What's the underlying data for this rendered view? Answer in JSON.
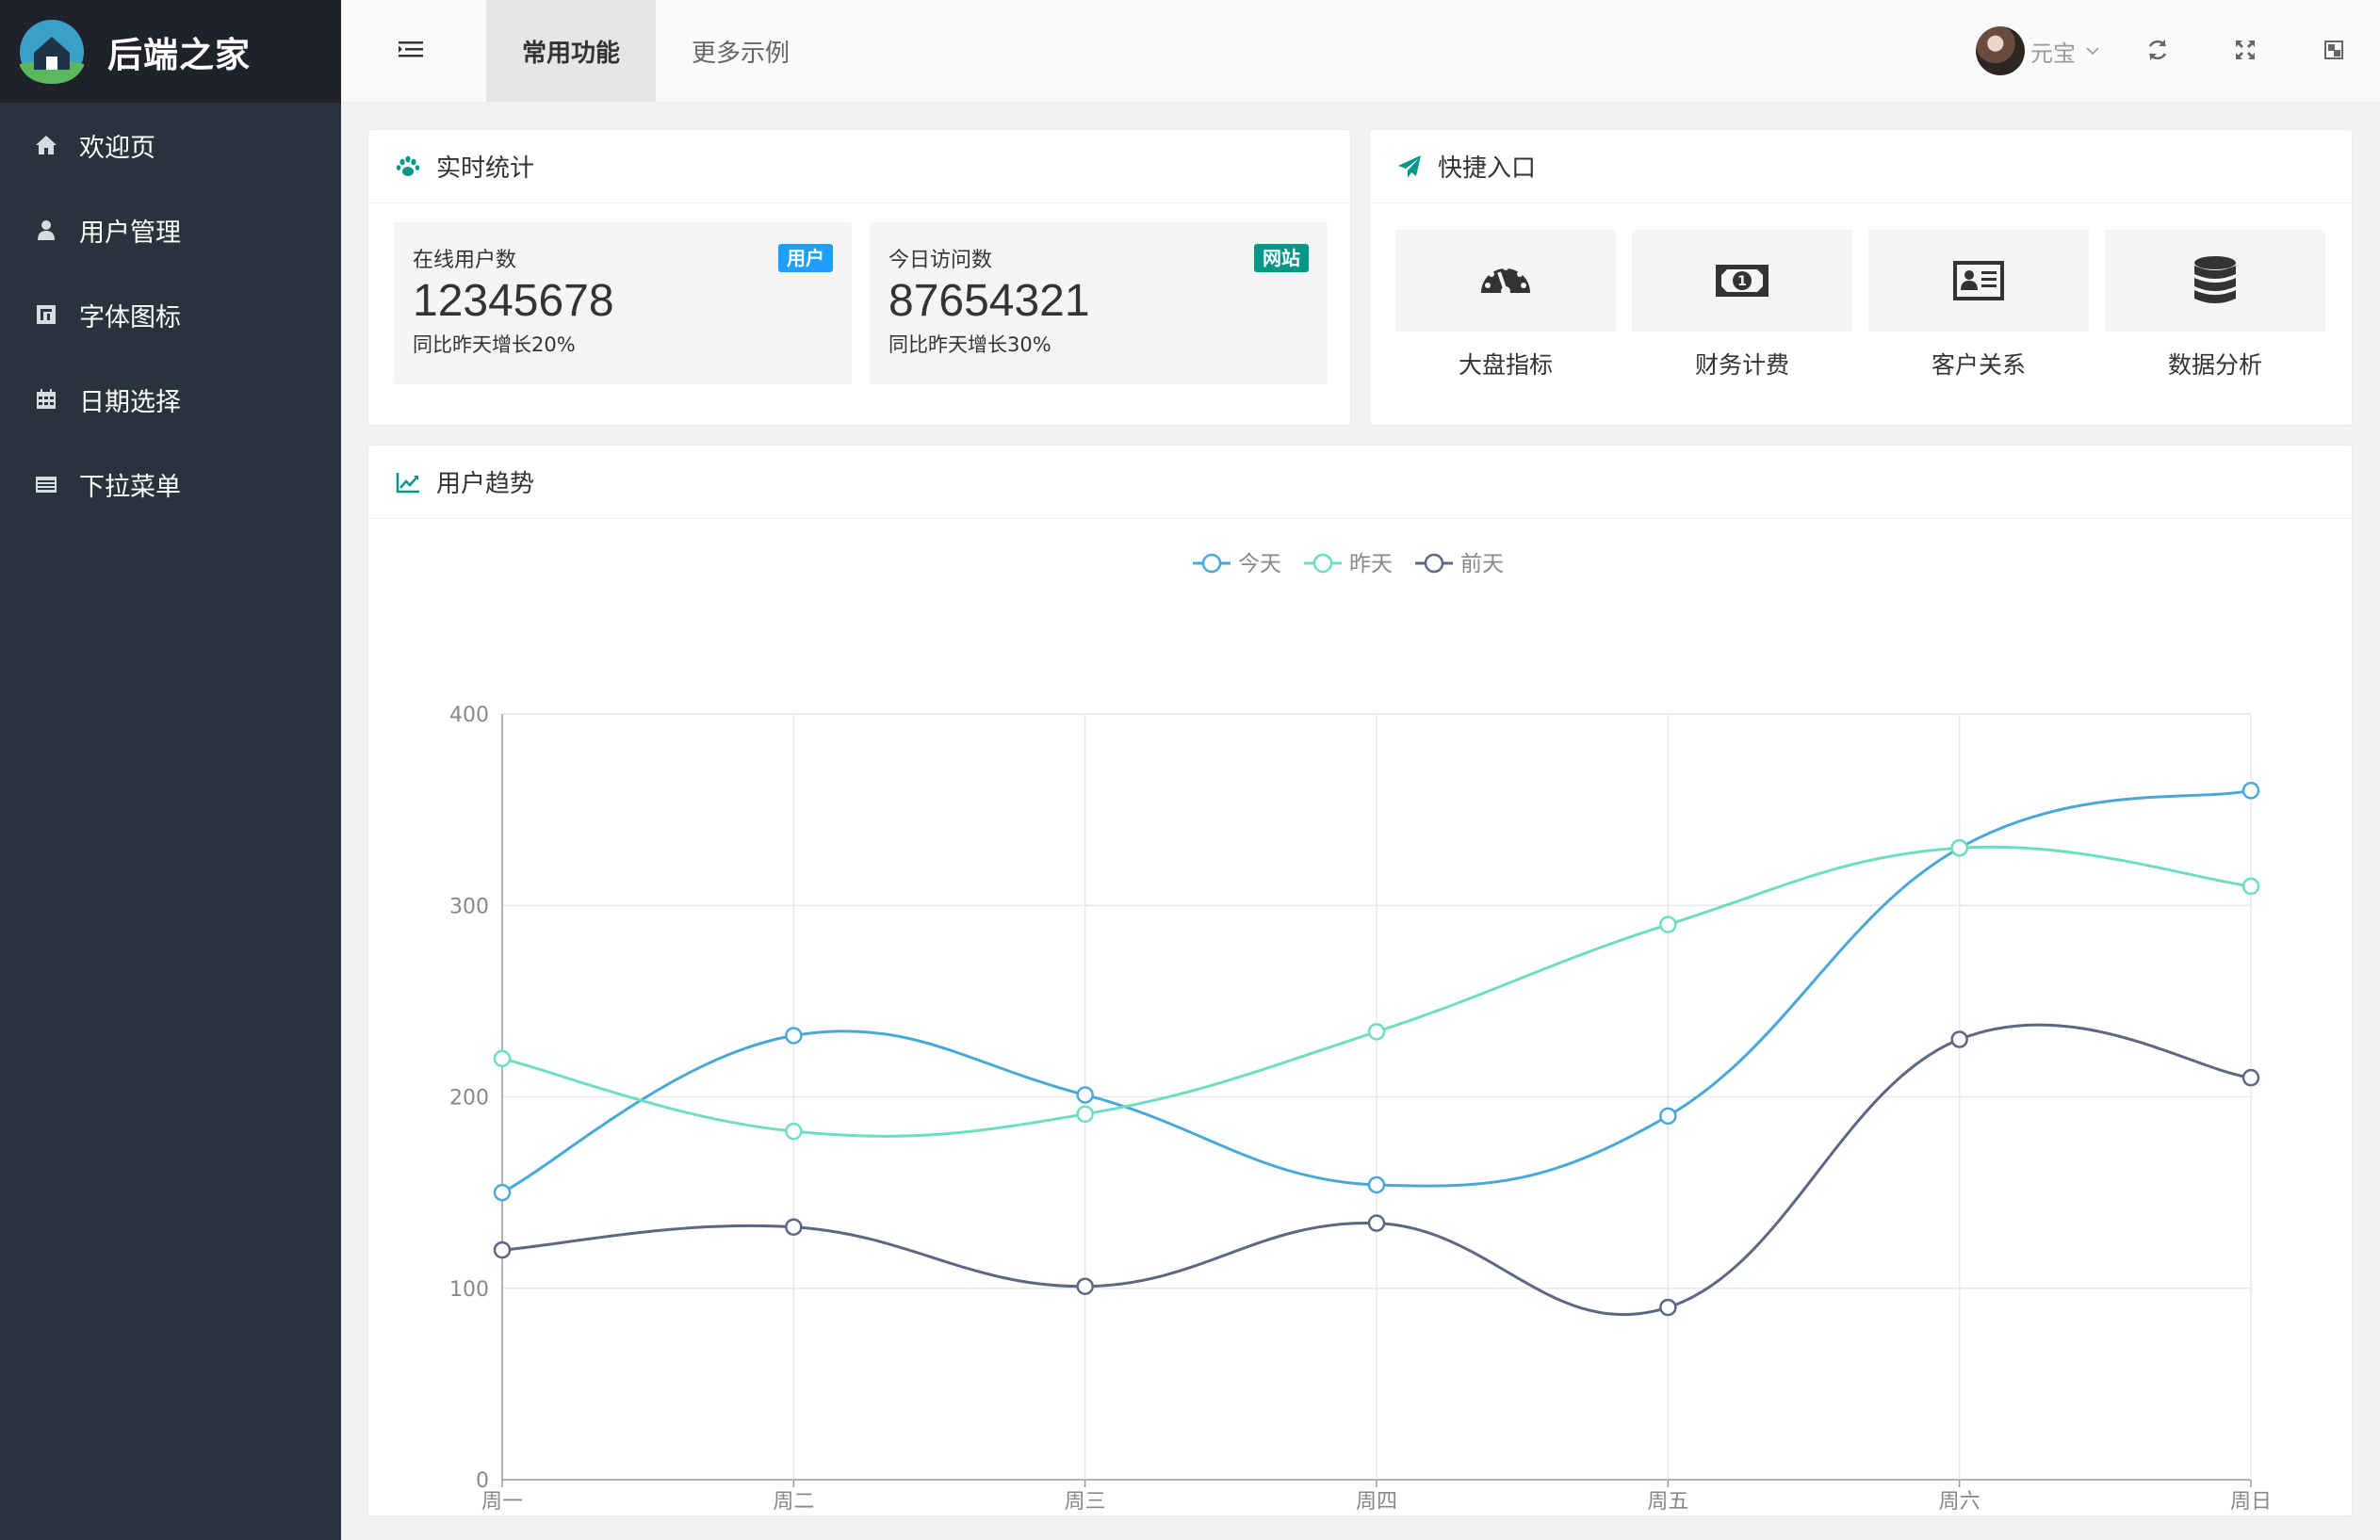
{
  "app": {
    "title": "后端之家"
  },
  "sidebar": {
    "items": [
      {
        "label": "欢迎页",
        "icon": "home-icon"
      },
      {
        "label": "用户管理",
        "icon": "user-icon"
      },
      {
        "label": "字体图标",
        "icon": "font-icon"
      },
      {
        "label": "日期选择",
        "icon": "calendar-icon"
      },
      {
        "label": "下拉菜单",
        "icon": "list-icon"
      }
    ]
  },
  "header": {
    "tabs": [
      {
        "label": "常用功能",
        "active": true
      },
      {
        "label": "更多示例",
        "active": false
      }
    ],
    "user_name": "元宝"
  },
  "stats": {
    "title": "实时统计",
    "items": [
      {
        "label": "在线用户数",
        "badge": "用户",
        "value": "12345678",
        "desc": "同比昨天增长20%",
        "badge_color": "#1e9fff"
      },
      {
        "label": "今日访问数",
        "badge": "网站",
        "value": "87654321",
        "desc": "同比昨天增长30%",
        "badge_color": "#009688"
      }
    ]
  },
  "quick": {
    "title": "快捷入口",
    "items": [
      {
        "label": "大盘指标",
        "icon": "dashboard-icon"
      },
      {
        "label": "财务计费",
        "icon": "money-icon"
      },
      {
        "label": "客户关系",
        "icon": "contact-card-icon"
      },
      {
        "label": "数据分析",
        "icon": "database-icon"
      }
    ]
  },
  "trend": {
    "title": "用户趋势"
  },
  "chart_data": {
    "type": "line",
    "smooth": true,
    "categories": [
      "周一",
      "周二",
      "周三",
      "周四",
      "周五",
      "周六",
      "周日"
    ],
    "ylim": [
      0,
      400
    ],
    "yticks": [
      0,
      100,
      200,
      300,
      400
    ],
    "grid": true,
    "legend_position": "top-center",
    "series": [
      {
        "name": "今天",
        "color": "#4aa8d8",
        "values": [
          150,
          232,
          201,
          154,
          190,
          330,
          360
        ]
      },
      {
        "name": "昨天",
        "color": "#6fddc0",
        "values": [
          220,
          182,
          191,
          234,
          290,
          330,
          310
        ]
      },
      {
        "name": "前天",
        "color": "#5c6784",
        "values": [
          120,
          132,
          101,
          134,
          90,
          230,
          210
        ]
      }
    ]
  }
}
